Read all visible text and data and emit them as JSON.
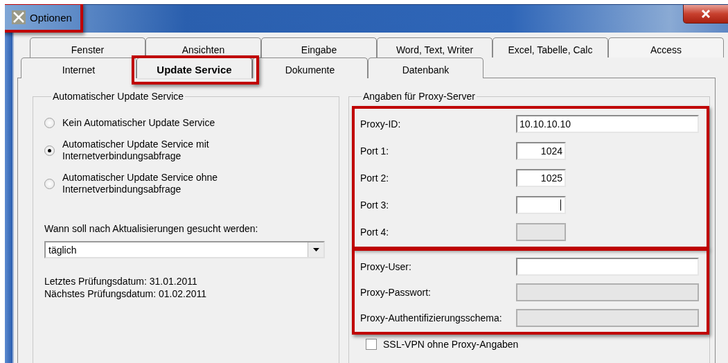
{
  "window": {
    "title": "Optionen",
    "highlighted": true
  },
  "tab_rows": [
    [
      {
        "label": "Fenster",
        "selected": false,
        "highlighted": false
      },
      {
        "label": "Ansichten",
        "selected": false,
        "highlighted": false
      },
      {
        "label": "Eingabe",
        "selected": false,
        "highlighted": false
      },
      {
        "label": "Word, Text, Writer",
        "selected": false,
        "highlighted": false
      },
      {
        "label": "Excel, Tabelle, Calc",
        "selected": false,
        "highlighted": false
      },
      {
        "label": "Access",
        "selected": false,
        "highlighted": false
      }
    ],
    [
      {
        "label": "Internet",
        "selected": false,
        "highlighted": false
      },
      {
        "label": "Update Service",
        "selected": true,
        "highlighted": true
      },
      {
        "label": "Dokumente",
        "selected": false,
        "highlighted": false
      },
      {
        "label": "Datenbank",
        "selected": false,
        "highlighted": false
      }
    ]
  ],
  "update_service": {
    "title": "Automatischer Update Service",
    "options": [
      {
        "label": "Kein Automatischer Update Service",
        "selected": false
      },
      {
        "label": "Automatischer Update Service mit\nInternetverbindungsabfrage",
        "selected": true
      },
      {
        "label": "Automatischer Update Service ohne\nInternetverbindungsabfrage",
        "selected": false
      }
    ],
    "schedule_label": "Wann soll nach Aktualisierungen gesucht werden:",
    "schedule": {
      "value": "täglich"
    },
    "last_check": "Letztes Prüfungsdatum: 31.01.2011",
    "next_check": "Nächstes Prüfungsdatum: 01.02.2011"
  },
  "proxy": {
    "title": "Angaben für Proxy-Server",
    "sections": [
      {
        "highlighted": true,
        "fields": [
          {
            "label": "Proxy-ID:",
            "value": "10.10.10.10",
            "kind": "long",
            "disabled": false,
            "focused": false
          },
          {
            "label": "Port 1:",
            "value": "1024",
            "kind": "short",
            "disabled": false,
            "focused": false
          },
          {
            "label": "Port 2:",
            "value": "1025",
            "kind": "short",
            "disabled": false,
            "focused": false
          },
          {
            "label": "Port 3:",
            "kind": "short",
            "disabled": false,
            "focused": true
          },
          {
            "label": "Port 4:",
            "kind": "short",
            "disabled": true,
            "focused": false
          }
        ]
      },
      {
        "highlighted": true,
        "fields": [
          {
            "label": "Proxy-User:",
            "kind": "long",
            "disabled": false,
            "focused": false
          },
          {
            "label": "Proxy-Passwort:",
            "kind": "long",
            "disabled": true,
            "focused": false
          },
          {
            "label": "Proxy-Authentifizierungsschema:",
            "kind": "long",
            "disabled": true,
            "focused": false
          }
        ]
      }
    ],
    "ssl_vpn": {
      "label": "SSL-VPN ohne Proxy-Angaben",
      "checked": false
    }
  }
}
